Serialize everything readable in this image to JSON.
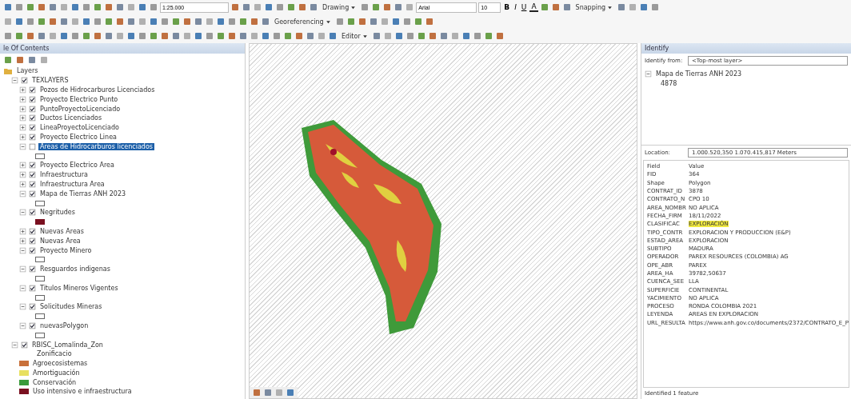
{
  "toolbar": {
    "scale": "1:25.000",
    "drawing_menu": "Drawing",
    "font": "Arial",
    "font_size": "10",
    "bold": "B",
    "italic": "I",
    "underline": "U",
    "font_color": "A",
    "snapping_menu": "Snapping",
    "georeferencing_menu": "Georeferencing",
    "editor_menu": "Editor"
  },
  "toc": {
    "title": "le Of Contents",
    "root": {
      "label": "Layers",
      "children": [
        {
          "label": "TEXLAYERS",
          "checked": true,
          "expanded": true,
          "selected": false,
          "children": [
            {
              "label": "Pozos de Hidrocarburos Licenciados",
              "checked": true,
              "selected": false
            },
            {
              "label": "Proyecto Electrico Punto",
              "checked": true,
              "selected": false
            },
            {
              "label": "PuntoProyectoLicenciado",
              "checked": true,
              "selected": false
            },
            {
              "label": "Ductos Licenciados",
              "checked": true,
              "selected": false
            },
            {
              "label": "LineaProyectoLicenciado",
              "checked": true,
              "selected": false
            },
            {
              "label": "Proyecto Electrico Linea",
              "checked": true,
              "selected": false
            },
            {
              "label": "Areas de Hidrocarburos licenciados",
              "checked": false,
              "selected": true,
              "legend": {
                "kind": "outline"
              }
            },
            {
              "label": "Proyecto Electrico Area",
              "checked": true,
              "selected": false
            },
            {
              "label": "Infraestructura",
              "checked": true,
              "selected": false
            },
            {
              "label": "Infraestructura Area",
              "checked": true,
              "selected": false
            },
            {
              "label": "Mapa de Tierras ANH 2023",
              "checked": true,
              "selected": false,
              "legend": {
                "kind": "outline"
              }
            },
            {
              "label": "Negritudes",
              "checked": true,
              "selected": false,
              "legend": {
                "kind": "fill",
                "color": "#7a1020"
              }
            },
            {
              "label": "Nuevas Areas",
              "checked": true,
              "selected": false
            },
            {
              "label": "Nuevas Area",
              "checked": true,
              "selected": false
            },
            {
              "label": "Proyecto Minero",
              "checked": true,
              "selected": false,
              "legend": {
                "kind": "outline"
              }
            },
            {
              "label": "Resguardos indigenas",
              "checked": true,
              "selected": false,
              "legend": {
                "kind": "outline"
              }
            },
            {
              "label": "Titulos Mineros Vigentes",
              "checked": true,
              "selected": false,
              "legend": {
                "kind": "outline"
              }
            },
            {
              "label": "Solicitudes Mineras",
              "checked": true,
              "selected": false,
              "legend": {
                "kind": "outline"
              }
            },
            {
              "label": "nuevasPolygon",
              "checked": true,
              "selected": false,
              "legend": {
                "kind": "outline"
              }
            }
          ]
        },
        {
          "label": "RBISC_Lomalinda_Zon",
          "checked": true,
          "expanded": true,
          "selected": false,
          "legend_title": "Zonificacio",
          "classes": [
            {
              "label": "Agroecosistemas",
              "color": "#c8703a"
            },
            {
              "label": "Amortiguación",
              "color": "#e8e060"
            },
            {
              "label": "Conservación",
              "color": "#3a9a3a"
            },
            {
              "label": "Uso intensivo e infraestructura",
              "color": "#7a1020"
            }
          ]
        }
      ]
    }
  },
  "identify": {
    "title": "Identify",
    "from_label": "Identify from:",
    "from_value": "<Top-most layer>",
    "tree": {
      "label": "Mapa de Tierras ANH 2023",
      "expanded": true,
      "children": [
        "4878"
      ]
    },
    "location_label": "Location:",
    "location_value": "1.000.520,350  1.070.415,817 Meters",
    "columns": [
      "Field",
      "Value"
    ],
    "rows": [
      {
        "field": "FID",
        "value": "364",
        "highlighted": false
      },
      {
        "field": "Shape",
        "value": "Polygon",
        "highlighted": false
      },
      {
        "field": "CONTRAT_ID",
        "value": "3878",
        "highlighted": false
      },
      {
        "field": "CONTRATO_N",
        "value": "CPO 10",
        "highlighted": false
      },
      {
        "field": "AREA_NOMBR",
        "value": "NO APLICA",
        "highlighted": false
      },
      {
        "field": "FECHA_FIRM",
        "value": "18/11/2022",
        "highlighted": false
      },
      {
        "field": "CLASIFICAC",
        "value": "EXPLORACIÓN",
        "highlighted": true
      },
      {
        "field": "TIPO_CONTR",
        "value": "EXPLORACION Y PRODUCCION (E&P)",
        "highlighted": false
      },
      {
        "field": "ESTAD_AREA",
        "value": "EXPLORACION",
        "highlighted": false
      },
      {
        "field": "SUBTIPO",
        "value": "MADURA",
        "highlighted": false
      },
      {
        "field": "OPERADOR",
        "value": "PAREX RESOURCES (COLOMBIA) AG",
        "highlighted": false
      },
      {
        "field": "OPE_ABR",
        "value": "PAREX",
        "highlighted": false
      },
      {
        "field": "AREA_HA",
        "value": "39782,50637",
        "highlighted": false
      },
      {
        "field": "CUENCA_SEE",
        "value": "LLA",
        "highlighted": false
      },
      {
        "field": "SUPERFICIE",
        "value": "CONTINENTAL",
        "highlighted": false
      },
      {
        "field": "YACIMIENTO",
        "value": "NO APLICA",
        "highlighted": false
      },
      {
        "field": "PROCESO",
        "value": "RONDA COLOMBIA 2021",
        "highlighted": false
      },
      {
        "field": "LEYENDA",
        "value": "AREAS EN EXPLORACION",
        "highlighted": false
      },
      {
        "field": "URL_RESULTA",
        "value": "https://www.anh.gov.co/documents/2372/CONTRATO_E_P",
        "highlighted": false
      }
    ],
    "status": "Identified 1 feature"
  }
}
